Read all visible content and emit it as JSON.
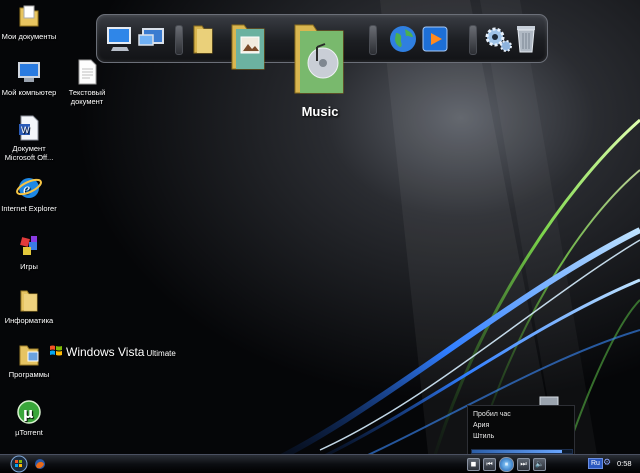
{
  "desktop": {
    "icons": [
      {
        "label": "Мои документы",
        "icon": "my-documents-folder-icon"
      },
      {
        "label": "Мой компьютер",
        "icon": "my-computer-icon"
      },
      {
        "label": "Текстовый\nдокумент",
        "icon": "text-document-icon"
      },
      {
        "label": "Документ\nMicrosoft Off...",
        "icon": "word-document-icon"
      },
      {
        "label": "Internet Explorer",
        "icon": "internet-explorer-icon"
      },
      {
        "label": "Игры",
        "icon": "games-icon"
      },
      {
        "label": "Информатика",
        "icon": "folder-icon"
      },
      {
        "label": "Программы",
        "icon": "programs-folder-icon"
      },
      {
        "label": "µTorrent",
        "icon": "utorrent-icon"
      }
    ],
    "logo": {
      "text": "Windows Vista",
      "edition": "Ultimate"
    }
  },
  "dock": {
    "caption": "Music",
    "items": [
      "computer-icon",
      "network-icon",
      "folder-icon",
      "pictures-folder-icon",
      "music-folder-icon",
      "globe-browser-icon",
      "media-player-icon",
      "settings-gears-icon",
      "recycle-bin-icon"
    ]
  },
  "media_widget": {
    "tracks": [
      "Пробил час",
      "Ария",
      "Штиль"
    ],
    "progress": 0.9
  },
  "taskbar": {
    "language": "Ru",
    "clock": "0:58"
  },
  "colors": {
    "accent_blue": "#3a8cff",
    "accent_green": "#7bd44a",
    "taskbar": "#0c0e12"
  }
}
